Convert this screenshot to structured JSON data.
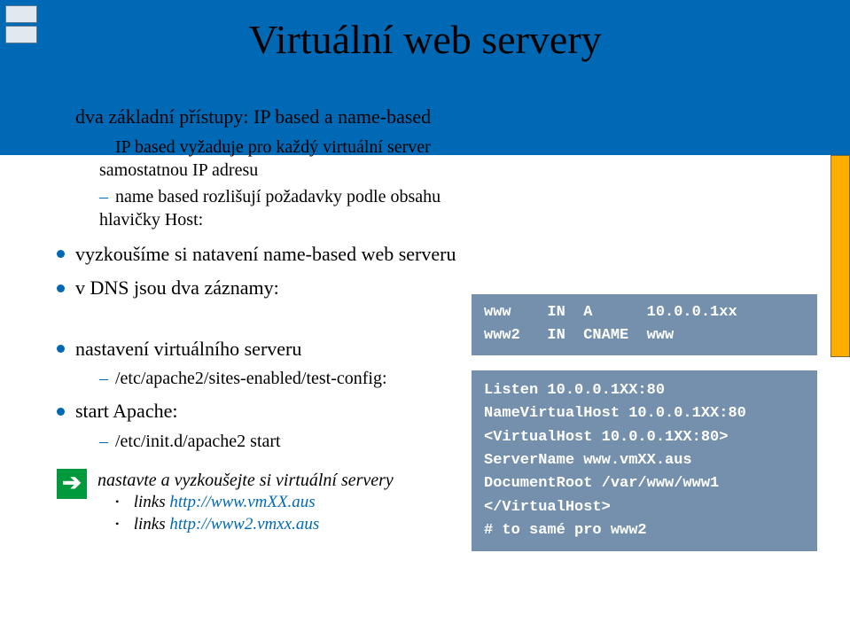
{
  "slide": {
    "title": "Virtuální web servery"
  },
  "bullets": {
    "b1": "dva základní přístupy: IP based a name-based",
    "b1_sub1": "IP based vyžaduje pro každý virtuální server samostatnou IP adresu",
    "b1_sub2": "name based rozlišují požadavky podle obsahu hlavičky Host:",
    "b2": "vyzkoušíme si natavení name-based web serveru",
    "b3": "v DNS jsou dva záznamy:",
    "b4": "nastavení virtuálního serveru",
    "b4_sub1": "/etc/apache2/sites-enabled/test-config:",
    "b5": "start Apache:",
    "b5_sub1": "/etc/init.d/apache2 start"
  },
  "exercise": {
    "arrow": "➔",
    "title": "nastavte a vyzkoušejte si virtuální servery",
    "link1_prefix": "links ",
    "link1": "http://www.vmXX.aus",
    "link2_prefix": "links ",
    "link2": "http://www2.vmxx.aus"
  },
  "dns_box": "www    IN  A      10.0.0.1xx\nwww2   IN  CNAME  www",
  "vhost_box": "Listen 10.0.0.1XX:80\nNameVirtualHost 10.0.0.1XX:80\n<VirtualHost 10.0.0.1XX:80>\nServerName www.vmXX.aus\nDocumentRoot /var/www/www1\n</VirtualHost>\n# to samé pro www2"
}
